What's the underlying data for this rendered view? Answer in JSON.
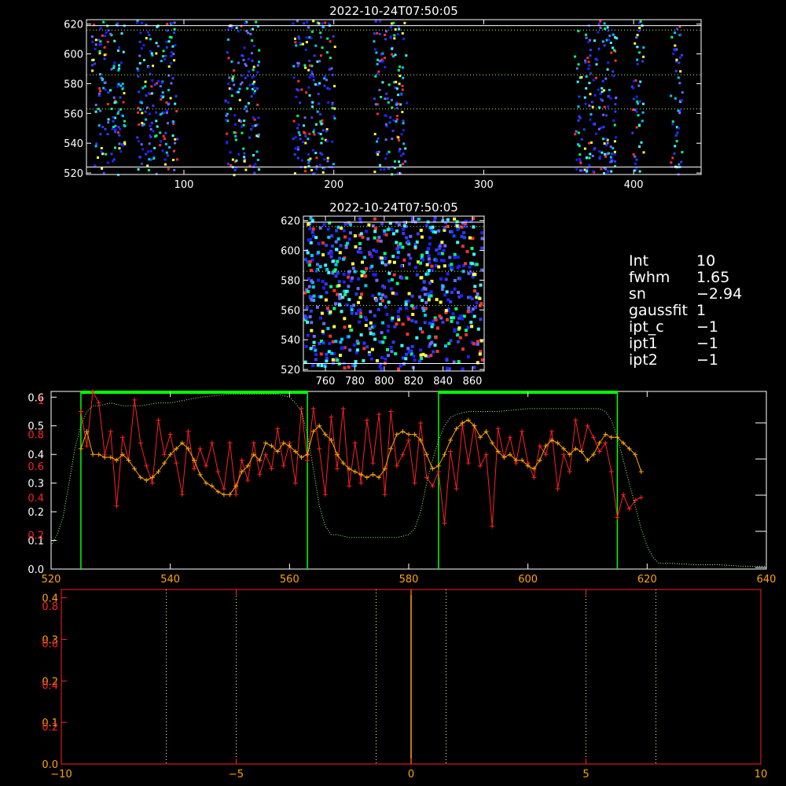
{
  "colors": {
    "axis": "#ffffff",
    "red": "#ff2020",
    "orange": "#ffa500",
    "green": "#00ff00",
    "greenDotted": "#a0ff80",
    "lightYellow": "#ffff99",
    "bottomAxis": "#ff2020"
  },
  "info": {
    "rows": [
      {
        "label": "Int",
        "value": "10"
      },
      {
        "label": "fwhm",
        "value": "1.65"
      },
      {
        "label": "sn",
        "value": "−2.94"
      },
      {
        "label": "gaussfit",
        "value": "1"
      },
      {
        "label": "ipt_c",
        "value": "−1"
      },
      {
        "label": "ipt1",
        "value": "−1"
      },
      {
        "label": "ipt2",
        "value": "−1"
      }
    ]
  },
  "chart_data": [
    {
      "id": "top_image",
      "type": "heatmap",
      "title": "2022-10-24T07:50:05",
      "xlim": [
        35,
        445
      ],
      "ylim": [
        519,
        623
      ],
      "xticks": [
        100,
        200,
        300,
        400
      ],
      "yticks": [
        520,
        540,
        560,
        580,
        600,
        620
      ],
      "hlines_solid": [
        524,
        619
      ],
      "hlines_dotted": [
        563,
        586,
        616
      ],
      "column_bands": [
        [
          38,
          60
        ],
        [
          68,
          95
        ],
        [
          127,
          150
        ],
        [
          172,
          200
        ],
        [
          226,
          248
        ],
        [
          360,
          388
        ],
        [
          398,
          406
        ],
        [
          424,
          432
        ]
      ]
    },
    {
      "id": "middle_image",
      "type": "heatmap",
      "title": "2022-10-24T07:50:05",
      "xlim": [
        745,
        868
      ],
      "ylim": [
        519,
        623
      ],
      "xticks": [
        760,
        780,
        800,
        820,
        840,
        860
      ],
      "yticks": [
        520,
        540,
        560,
        580,
        600,
        620
      ],
      "hlines_solid": [
        524,
        619
      ],
      "hlines_dotted": [
        563,
        586,
        616
      ]
    },
    {
      "id": "profile_plot",
      "type": "line",
      "xlim": [
        520,
        640
      ],
      "xticks": [
        520,
        540,
        560,
        580,
        600,
        620,
        640
      ],
      "left_axis_white": {
        "ylim": [
          0,
          0.62
        ],
        "ticks": [
          0.0,
          0.1,
          0.2,
          0.3,
          0.4,
          0.5,
          0.6
        ],
        "tick_labels": [
          "0.0",
          "0.1",
          "0.2",
          "0.3",
          "0.4",
          "0.5",
          "0.6"
        ]
      },
      "left_axis_red": {
        "ylim": [
          0,
          0.62
        ],
        "ticks": [
          0.12,
          0.25,
          0.36,
          0.47,
          0.59
        ],
        "tick_labels": [
          "0.2",
          "0.4",
          "0.6",
          "0.8",
          "1"
        ]
      },
      "green_boxes": [
        [
          525,
          563
        ],
        [
          585,
          615
        ]
      ],
      "series": [
        {
          "color": "red",
          "marker": "+",
          "x": [
            525,
            526,
            527,
            528,
            529,
            530,
            531,
            532,
            533,
            534,
            535,
            536,
            537,
            538,
            539,
            540,
            541,
            542,
            543,
            544,
            545,
            546,
            547,
            548,
            549,
            550,
            551,
            552,
            553,
            554,
            555,
            556,
            557,
            558,
            559,
            560,
            561,
            562,
            563,
            564,
            565,
            566,
            567,
            568,
            569,
            570,
            571,
            572,
            573,
            574,
            575,
            576,
            577,
            578,
            579,
            580,
            581,
            582,
            583,
            584,
            585,
            586,
            587,
            588,
            589,
            590,
            591,
            592,
            593,
            594,
            595,
            596,
            597,
            598,
            599,
            600,
            601,
            602,
            603,
            604,
            605,
            606,
            607,
            608,
            609,
            610,
            611,
            612,
            613,
            614,
            615,
            616,
            617,
            618,
            619
          ],
          "y": [
            0.55,
            0.43,
            0.62,
            0.58,
            0.4,
            0.48,
            0.22,
            0.46,
            0.38,
            0.59,
            0.44,
            0.36,
            0.3,
            0.52,
            0.4,
            0.47,
            0.37,
            0.26,
            0.48,
            0.35,
            0.42,
            0.36,
            0.44,
            0.34,
            0.28,
            0.44,
            0.26,
            0.38,
            0.31,
            0.44,
            0.33,
            0.4,
            0.35,
            0.49,
            0.36,
            0.44,
            0.3,
            0.56,
            0.38,
            0.56,
            0.42,
            0.26,
            0.53,
            0.35,
            0.56,
            0.29,
            0.44,
            0.3,
            0.52,
            0.37,
            0.54,
            0.26,
            0.55,
            0.36,
            0.4,
            0.45,
            0.3,
            0.51,
            0.32,
            0.29,
            0.34,
            0.16,
            0.41,
            0.28,
            0.5,
            0.37,
            0.5,
            0.36,
            0.4,
            0.15,
            0.49,
            0.39,
            0.46,
            0.37,
            0.48,
            0.37,
            0.32,
            0.43,
            0.4,
            0.48,
            0.28,
            0.4,
            0.34,
            0.52,
            0.41,
            0.5,
            0.46,
            0.41,
            0.44,
            0.34,
            0.18,
            0.26,
            0.21,
            0.24,
            0.25
          ]
        },
        {
          "color": "orange",
          "marker": "+",
          "x": [
            525,
            526,
            527,
            528,
            529,
            530,
            531,
            532,
            533,
            534,
            535,
            536,
            537,
            538,
            539,
            540,
            541,
            542,
            543,
            544,
            545,
            546,
            547,
            548,
            549,
            550,
            551,
            552,
            553,
            554,
            555,
            556,
            557,
            558,
            559,
            560,
            561,
            562,
            563,
            564,
            565,
            566,
            567,
            568,
            569,
            570,
            571,
            572,
            573,
            574,
            575,
            576,
            577,
            578,
            579,
            580,
            581,
            582,
            583,
            584,
            585,
            586,
            587,
            588,
            589,
            590,
            591,
            592,
            593,
            594,
            595,
            596,
            597,
            598,
            599,
            600,
            601,
            602,
            603,
            604,
            605,
            606,
            607,
            608,
            609,
            610,
            611,
            612,
            613,
            614,
            615,
            616,
            617,
            618,
            619
          ],
          "y": [
            0.42,
            0.48,
            0.4,
            0.4,
            0.39,
            0.39,
            0.38,
            0.4,
            0.38,
            0.35,
            0.32,
            0.31,
            0.32,
            0.34,
            0.37,
            0.4,
            0.42,
            0.44,
            0.42,
            0.38,
            0.33,
            0.3,
            0.29,
            0.27,
            0.26,
            0.26,
            0.29,
            0.34,
            0.36,
            0.4,
            0.38,
            0.44,
            0.43,
            0.41,
            0.44,
            0.43,
            0.41,
            0.39,
            0.4,
            0.48,
            0.5,
            0.47,
            0.45,
            0.4,
            0.37,
            0.35,
            0.34,
            0.33,
            0.32,
            0.33,
            0.32,
            0.35,
            0.42,
            0.47,
            0.48,
            0.47,
            0.47,
            0.45,
            0.4,
            0.35,
            0.36,
            0.4,
            0.45,
            0.49,
            0.51,
            0.52,
            0.5,
            0.46,
            0.48,
            0.44,
            0.41,
            0.39,
            0.4,
            0.38,
            0.38,
            0.36,
            0.35,
            0.38,
            0.43,
            0.45,
            0.44,
            0.42,
            0.4,
            0.42,
            0.41,
            0.38,
            0.4,
            0.44,
            0.47,
            0.46,
            0.46,
            0.44,
            0.42,
            0.4,
            0.34
          ]
        },
        {
          "color": "greenDotted",
          "marker": "none",
          "dotted": true,
          "x": [
            520,
            521,
            522,
            523,
            524,
            525,
            526,
            527,
            528,
            530,
            532,
            535,
            538,
            540,
            545,
            550,
            555,
            558,
            560,
            561,
            562,
            563,
            564,
            565,
            566,
            567,
            568,
            570,
            575,
            578,
            580,
            581,
            582,
            583,
            584,
            585,
            586,
            587,
            588,
            590,
            595,
            600,
            605,
            610,
            612,
            613,
            614,
            615,
            616,
            617,
            618,
            619,
            620,
            621,
            622,
            624,
            628,
            632,
            636,
            640
          ],
          "y": [
            0.08,
            0.12,
            0.18,
            0.3,
            0.42,
            0.5,
            0.55,
            0.57,
            0.57,
            0.58,
            0.57,
            0.57,
            0.58,
            0.58,
            0.6,
            0.61,
            0.61,
            0.61,
            0.6,
            0.58,
            0.55,
            0.47,
            0.35,
            0.22,
            0.15,
            0.12,
            0.12,
            0.11,
            0.11,
            0.11,
            0.12,
            0.14,
            0.2,
            0.3,
            0.38,
            0.45,
            0.5,
            0.53,
            0.54,
            0.55,
            0.55,
            0.56,
            0.56,
            0.56,
            0.56,
            0.55,
            0.52,
            0.46,
            0.38,
            0.3,
            0.22,
            0.14,
            0.08,
            0.04,
            0.02,
            0.02,
            0.015,
            0.015,
            0.01,
            0.01
          ]
        }
      ]
    },
    {
      "id": "bottom_plot",
      "type": "line",
      "xlim": [
        -10,
        10
      ],
      "xticks": [
        -10,
        -5,
        0,
        5,
        10
      ],
      "left_axis_white": {
        "ylim": [
          0,
          0.42
        ],
        "ticks": [
          0.0,
          0.1,
          0.2,
          0.3,
          0.4
        ],
        "tick_labels": [
          "0.0",
          "0.1",
          "0.2",
          "0.3",
          "0.4"
        ]
      },
      "left_axis_red": {
        "ylim": [
          0,
          0.42
        ],
        "ticks": [
          0.09,
          0.19,
          0.29,
          0.38
        ],
        "tick_labels": [
          "0.2",
          "0.4",
          "0.6",
          "0.8"
        ]
      },
      "vlines_dotted": [
        -7,
        -5,
        -1,
        1,
        5,
        7
      ],
      "vline_solid": 0
    }
  ]
}
